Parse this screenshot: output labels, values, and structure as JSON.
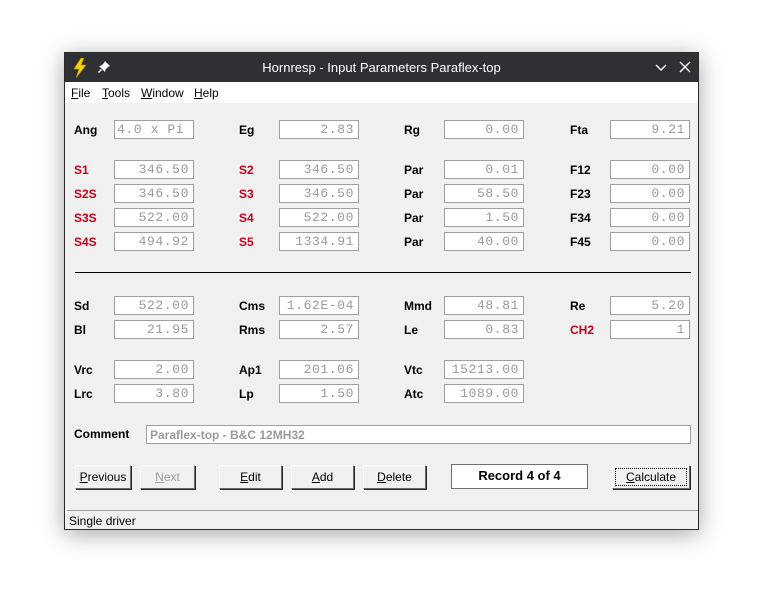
{
  "window": {
    "title": "Hornresp - Input Parameters Paraflex-top"
  },
  "menu": [
    {
      "key": "F",
      "rest": "ile"
    },
    {
      "key": "T",
      "rest": "ools"
    },
    {
      "key": "W",
      "rest": "indow"
    },
    {
      "key": "H",
      "rest": "elp"
    }
  ],
  "params": {
    "Ang": {
      "label": "Ang",
      "value": "4.0 x Pi"
    },
    "Eg": {
      "label": "Eg",
      "value": "2.83"
    },
    "Rg": {
      "label": "Rg",
      "value": "0.00"
    },
    "Fta": {
      "label": "Fta",
      "value": "9.21"
    },
    "S1": {
      "label": "S1",
      "value": "346.50"
    },
    "S2": {
      "label": "S2",
      "value": "346.50"
    },
    "Par1": {
      "label": "Par",
      "value": "0.01"
    },
    "F12": {
      "label": "F12",
      "value": "0.00"
    },
    "S2S": {
      "label": "S2S",
      "value": "346.50"
    },
    "S3": {
      "label": "S3",
      "value": "346.50"
    },
    "Par2": {
      "label": "Par",
      "value": "58.50"
    },
    "F23": {
      "label": "F23",
      "value": "0.00"
    },
    "S3S": {
      "label": "S3S",
      "value": "522.00"
    },
    "S4": {
      "label": "S4",
      "value": "522.00"
    },
    "Par3": {
      "label": "Par",
      "value": "1.50"
    },
    "F34": {
      "label": "F34",
      "value": "0.00"
    },
    "S4S": {
      "label": "S4S",
      "value": "494.92"
    },
    "S5": {
      "label": "S5",
      "value": "1334.91"
    },
    "Par4": {
      "label": "Par",
      "value": "40.00"
    },
    "F45": {
      "label": "F45",
      "value": "0.00"
    },
    "Sd": {
      "label": "Sd",
      "value": "522.00"
    },
    "Cms": {
      "label": "Cms",
      "value": "1.62E-04"
    },
    "Mmd": {
      "label": "Mmd",
      "value": "48.81"
    },
    "Re": {
      "label": "Re",
      "value": "5.20"
    },
    "Bl": {
      "label": "Bl",
      "value": "21.95"
    },
    "Rms": {
      "label": "Rms",
      "value": "2.57"
    },
    "Le": {
      "label": "Le",
      "value": "0.83"
    },
    "CH2": {
      "label": "CH2",
      "value": "1"
    },
    "Vrc": {
      "label": "Vrc",
      "value": "2.00"
    },
    "Ap1": {
      "label": "Ap1",
      "value": "201.06"
    },
    "Vtc": {
      "label": "Vtc",
      "value": "15213.00"
    },
    "Lrc": {
      "label": "Lrc",
      "value": "3.80"
    },
    "Lp": {
      "label": "Lp",
      "value": "1.50"
    },
    "Atc": {
      "label": "Atc",
      "value": "1089.00"
    }
  },
  "comment": {
    "label": "Comment",
    "value": "Paraflex-top - B&C 12MH32"
  },
  "buttons": {
    "previous": {
      "key": "P",
      "rest": "revious"
    },
    "next": {
      "key": "N",
      "rest": "ext"
    },
    "edit": {
      "key": "E",
      "rest": "dit"
    },
    "add": {
      "key": "A",
      "rest": "dd"
    },
    "delete": {
      "key": "D",
      "rest": "elete"
    },
    "calculate": {
      "key": "C",
      "rest": "alculate"
    }
  },
  "record": "Record 4 of 4",
  "status": "Single driver",
  "colors": {
    "highlight_label": "#c8001e",
    "titlebar": "#2f3033",
    "field_text": "#9a9a9a"
  }
}
